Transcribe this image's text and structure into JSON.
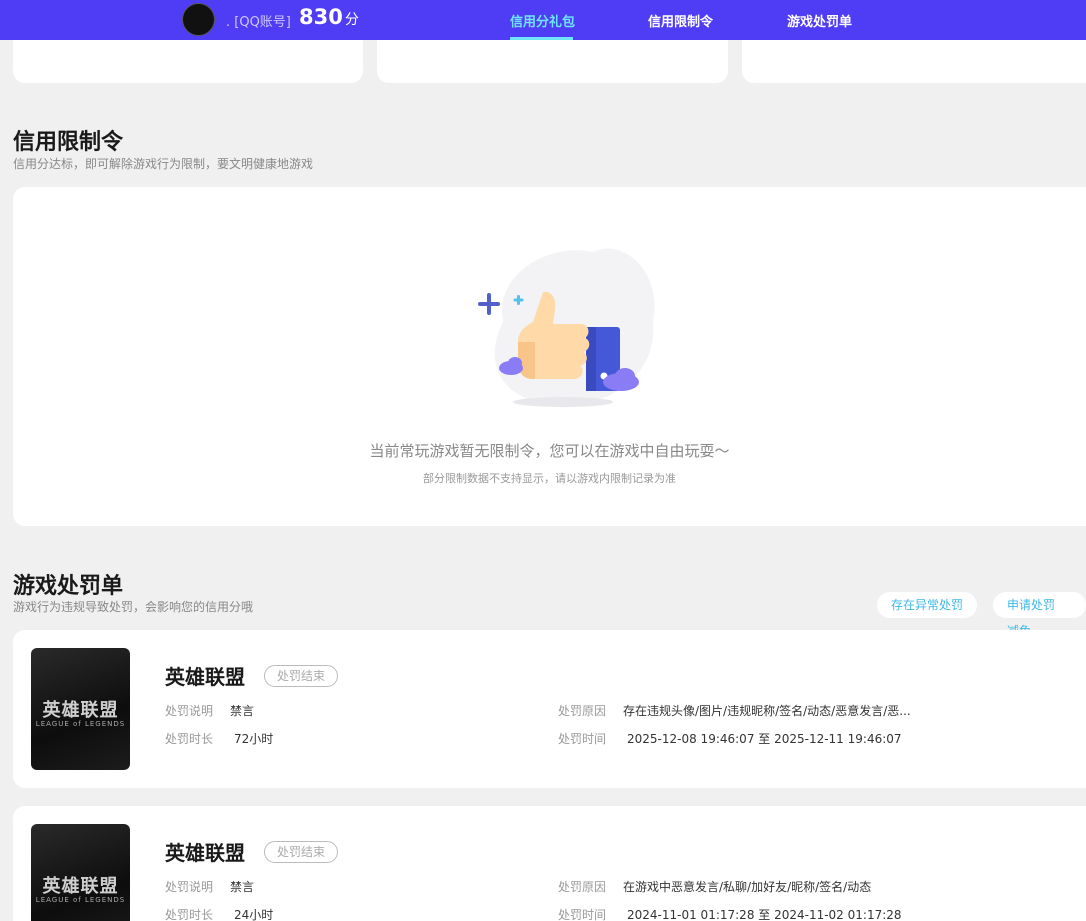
{
  "header": {
    "account_label": ". [QQ账号]",
    "score": "830",
    "score_unit": "分",
    "tabs": [
      {
        "label": "信用分礼包",
        "active": true
      },
      {
        "label": "信用限制令",
        "active": false
      },
      {
        "label": "游戏处罚单",
        "active": false
      }
    ]
  },
  "restriction": {
    "title": "信用限制令",
    "subtitle": "信用分达标，即可解除游戏行为限制，要文明健康地游戏",
    "empty_text": "当前常玩游戏暂无限制令，您可以在游戏中自由玩耍～",
    "empty_note": "部分限制数据不支持显示，请以游戏内限制记录为准"
  },
  "penalties": {
    "title": "游戏处罚单",
    "subtitle": "游戏行为违规导致处罚，会影响您的信用分哦",
    "actions": [
      "存在异常处罚",
      "申请处罚减免"
    ],
    "labels": {
      "desc": "处罚说明",
      "duration": "处罚时长",
      "reason": "处罚原因",
      "time": "处罚时间"
    },
    "items": [
      {
        "game": "英雄联盟",
        "cover_cn": "英雄联盟",
        "cover_en": "LEAGUE of LEGENDS",
        "status": "处罚结束",
        "desc": "禁言",
        "duration": "72小时",
        "reason": "存在违规头像/图片/违规昵称/签名/动态/恶意发言/恶...",
        "time": "2025-12-08 19:46:07 至 2025-12-11 19:46:07"
      },
      {
        "game": "英雄联盟",
        "cover_cn": "英雄联盟",
        "cover_en": "LEAGUE of LEGENDS",
        "status": "处罚结束",
        "desc": "禁言",
        "duration": "24小时",
        "reason": "在游戏中恶意发言/私聊/加好友/昵称/签名/动态",
        "time": "2024-11-01 01:17:28 至 2024-11-02 01:17:28"
      }
    ]
  },
  "colors": {
    "header_bg": "#4f3cf5",
    "active_tab": "#6fe4ff",
    "link": "#3fb8e8",
    "page_bg": "#f0f0f0"
  }
}
